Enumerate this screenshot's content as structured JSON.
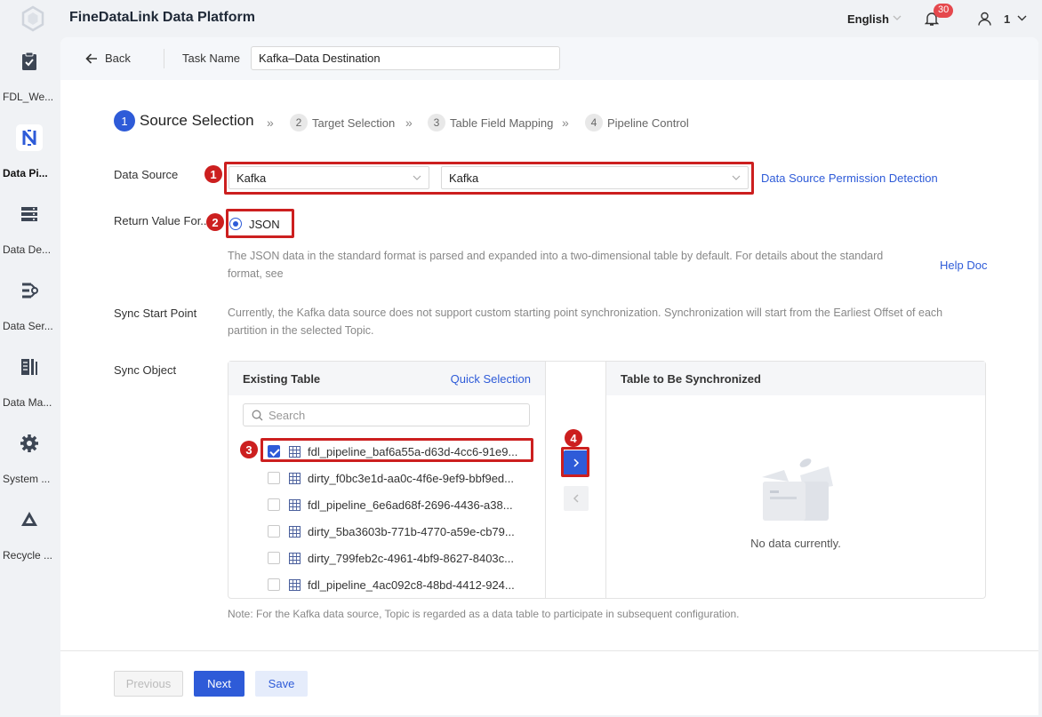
{
  "app": {
    "title": "FineDataLink Data Platform"
  },
  "header": {
    "language": "English",
    "notification_count": "30",
    "user_label": "1"
  },
  "sidebar": {
    "items": [
      {
        "label": "FDL_We...",
        "icon": "clipboard-check-icon"
      },
      {
        "label": "Data Pi...",
        "icon": "pipeline-icon",
        "active": true
      },
      {
        "label": "Data De...",
        "icon": "server-icon"
      },
      {
        "label": "Data Ser...",
        "icon": "data-service-icon"
      },
      {
        "label": "Data Ma...",
        "icon": "data-management-icon"
      },
      {
        "label": "System ...",
        "icon": "gear-icon"
      },
      {
        "label": "Recycle ...",
        "icon": "recycle-icon"
      }
    ]
  },
  "taskbar": {
    "back_label": "Back",
    "task_name_label": "Task Name",
    "task_name_value": "Kafka–Data Destination"
  },
  "steps": [
    {
      "num": "1",
      "label": "Source Selection",
      "active": true
    },
    {
      "num": "2",
      "label": "Target Selection"
    },
    {
      "num": "3",
      "label": "Table Field Mapping"
    },
    {
      "num": "4",
      "label": "Pipeline Control"
    }
  ],
  "form": {
    "data_source_label": "Data Source",
    "data_source_type": "Kafka",
    "data_source_name": "Kafka",
    "permission_link": "Data Source Permission Detection",
    "return_value_label": "Return Value For...",
    "return_value_option": "JSON",
    "return_value_desc": "The JSON data in the standard format is parsed and expanded into a two-dimensional table by default. For details about the standard format, see",
    "help_doc_link": "Help Doc",
    "sync_start_label": "Sync Start Point",
    "sync_start_desc": "Currently, the Kafka data source does not support custom starting point synchronization. Synchronization will start from the Earliest Offset of each partition in the selected Topic.",
    "sync_object_label": "Sync Object"
  },
  "transfer": {
    "existing_title": "Existing Table",
    "quick_selection": "Quick Selection",
    "search_placeholder": "Search",
    "items": [
      {
        "name": "fdl_pipeline_baf6a55a-d63d-4cc6-91e9...",
        "checked": true
      },
      {
        "name": "dirty_f0bc3e1d-aa0c-4f6e-9ef9-bbf9ed...",
        "checked": false
      },
      {
        "name": "fdl_pipeline_6e6ad68f-2696-4436-a38...",
        "checked": false
      },
      {
        "name": "dirty_5ba3603b-771b-4770-a59e-cb79...",
        "checked": false
      },
      {
        "name": "dirty_799feb2c-4961-4bf9-8627-8403c...",
        "checked": false
      },
      {
        "name": "fdl_pipeline_4ac092c8-48bd-4412-924...",
        "checked": false
      }
    ],
    "target_title": "Table to Be Synchronized",
    "empty_text": "No data currently."
  },
  "note": "Note: For the Kafka data source, Topic is regarded as a data table to participate in subsequent configuration.",
  "footer": {
    "previous": "Previous",
    "next": "Next",
    "save": "Save"
  },
  "annotations": [
    "1",
    "2",
    "3",
    "4"
  ],
  "colors": {
    "primary": "#2e5bd8",
    "highlight": "#cc1f1f",
    "badge": "#e5484d"
  }
}
